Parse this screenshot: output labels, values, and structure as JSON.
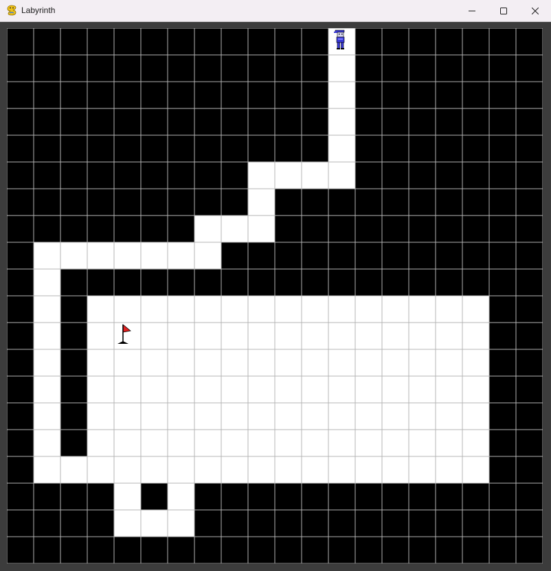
{
  "window": {
    "title": "Labyrinth",
    "app_icon": "snake-icon",
    "controls": {
      "minimize_icon": "minimize-icon",
      "maximize_icon": "maximize-icon",
      "close_icon": "close-icon"
    }
  },
  "game": {
    "grid": {
      "columns": 20,
      "rows": 20,
      "colors": {
        "wall": "#000000",
        "path": "#ffffff",
        "grid_line": "#b4b4b4"
      },
      "maze": [
        "############.#######",
        "############.#######",
        "############.#######",
        "############.#######",
        "############.#######",
        "#########....#######",
        "#########.##########",
        "#######...##########",
        "#.......############",
        "#.##################",
        "#.#...............##",
        "#.#...............##",
        "#.#...............##",
        "#.#...............##",
        "#.#...............##",
        "#.#...............##",
        "#.................##",
        "####.#.#############",
        "####...#############",
        "####################"
      ]
    },
    "player": {
      "icon": "player-character-icon",
      "cell": [
        12,
        0
      ],
      "colors": {
        "body": "#3a3ad8",
        "outline": "#000000"
      }
    },
    "goal": {
      "icon": "goal-flag-icon",
      "cell": [
        4,
        11
      ],
      "colors": {
        "flag": "#e02020",
        "pole": "#000000"
      }
    }
  }
}
